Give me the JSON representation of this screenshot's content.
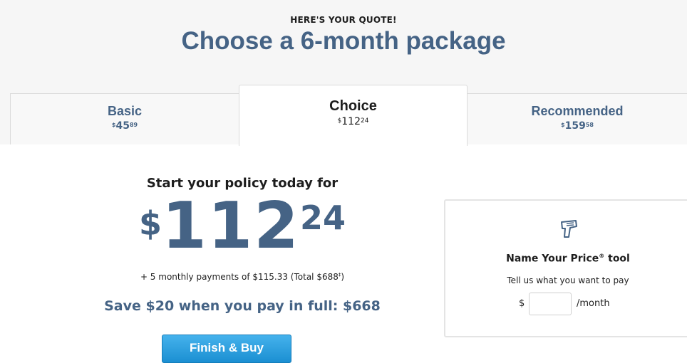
{
  "header": {
    "eyebrow": "HERE'S YOUR QUOTE!",
    "title": "Choose a 6-month package"
  },
  "tabs": [
    {
      "name": "Basic",
      "currency": "$",
      "whole": "45",
      "cents": "89",
      "selected": false
    },
    {
      "name": "Choice",
      "currency": "$",
      "whole": "112",
      "cents": "24",
      "selected": true
    },
    {
      "name": "Recommended",
      "currency": "$",
      "whole": "159",
      "cents": "58",
      "selected": false
    }
  ],
  "summary": {
    "lead": "Start your policy today for",
    "price_currency": "$",
    "price_whole": "112",
    "price_cents": "24",
    "installments_text": "+ 5 monthly payments of $115.33 (Total $688",
    "installments_mark": "‡",
    "installments_close": ")",
    "save_text": "Save $20 when you pay in full: $668",
    "buy_label": "Finish & Buy"
  },
  "name_your_price": {
    "icon": "price-gun-icon",
    "title": "Name Your Price",
    "title_mark": "®",
    "title_suffix": " tool",
    "subtitle": "Tell us what you want to pay",
    "currency": "$",
    "input_value": "",
    "input_placeholder": "",
    "unit": "/month"
  },
  "colors": {
    "brand_blue": "#456385",
    "button_blue": "#1b8fd2",
    "header_background": "#f6f6f6"
  }
}
